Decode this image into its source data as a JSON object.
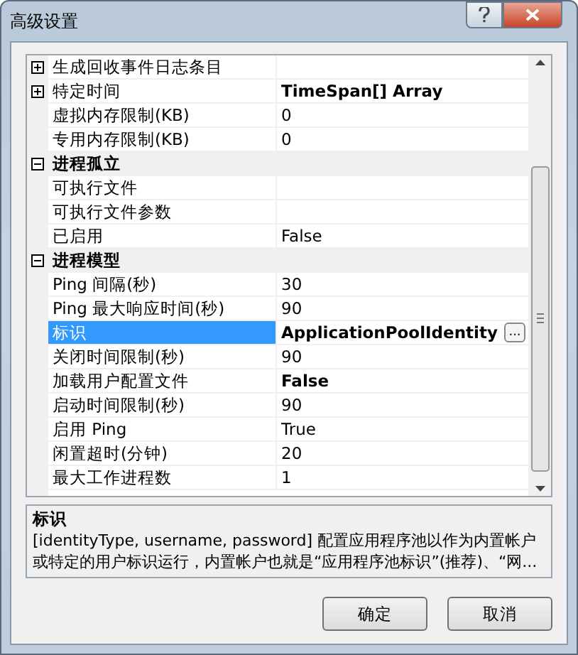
{
  "window": {
    "title": "高级设置"
  },
  "grid": {
    "rows": [
      {
        "kind": "property",
        "expanded": false,
        "name": "生成回收事件日志条目",
        "selected": false
      },
      {
        "kind": "property",
        "expanded": false,
        "name": "特定时间",
        "value": "TimeSpan[] Array",
        "modified": true,
        "selected": false
      },
      {
        "kind": "property",
        "name": "虚拟内存限制(KB)",
        "value": "0",
        "modified": false,
        "selected": false
      },
      {
        "kind": "property",
        "name": "专用内存限制(KB)",
        "value": "0",
        "modified": false,
        "selected": false
      },
      {
        "kind": "category",
        "expanded": true,
        "name": "进程孤立"
      },
      {
        "kind": "property",
        "name": "可执行文件",
        "selected": false
      },
      {
        "kind": "property",
        "name": "可执行文件参数",
        "selected": false
      },
      {
        "kind": "property",
        "name": "已启用",
        "value": "False",
        "modified": false,
        "selected": false
      },
      {
        "kind": "category",
        "expanded": true,
        "name": "进程模型"
      },
      {
        "kind": "property",
        "name": "Ping 间隔(秒)",
        "value": "30",
        "modified": false,
        "selected": false
      },
      {
        "kind": "property",
        "name": "Ping 最大响应时间(秒)",
        "value": "90",
        "modified": false,
        "selected": false
      },
      {
        "kind": "property",
        "name": "标识",
        "value": "ApplicationPoolIdentity",
        "modified": true,
        "selected": true,
        "button": "..."
      },
      {
        "kind": "property",
        "name": "关闭时间限制(秒)",
        "value": "90",
        "modified": false,
        "selected": false
      },
      {
        "kind": "property",
        "name": "加载用户配置文件",
        "value": "False",
        "modified": true,
        "selected": false
      },
      {
        "kind": "property",
        "name": "启动时间限制(秒)",
        "value": "90",
        "modified": false,
        "selected": false
      },
      {
        "kind": "property",
        "name": "启用 Ping",
        "value": "True",
        "modified": false,
        "selected": false
      },
      {
        "kind": "property",
        "name": "闲置超时(分钟)",
        "value": "20",
        "modified": false,
        "selected": false
      },
      {
        "kind": "property",
        "name": "最大工作进程数",
        "value": "1",
        "modified": false,
        "selected": false
      }
    ]
  },
  "description": {
    "title": "标识",
    "text": "[identityType, username, password] 配置应用程序池以作为内置帐户或特定的用户标识运行，内置帐户也就是“应用程序池标识”(推荐)、“网..."
  },
  "buttons": [
    {
      "label": "确定"
    },
    {
      "label": "取消"
    }
  ]
}
